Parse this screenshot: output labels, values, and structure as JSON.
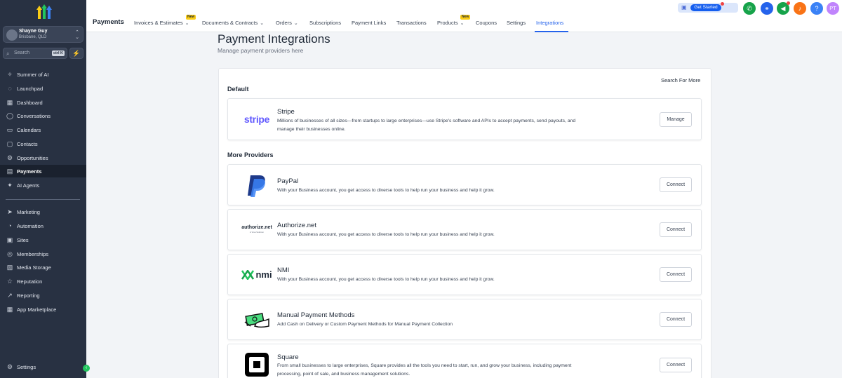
{
  "sidebar": {
    "account": {
      "name": "Shayne Guy",
      "location": "Brisbane, QLD"
    },
    "search": {
      "placeholder": "Search",
      "shortcut": "ctrl K"
    },
    "items": [
      {
        "label": "Summer of AI",
        "icon": "sparkle-icon"
      },
      {
        "label": "Launchpad",
        "icon": "rocket-icon"
      },
      {
        "label": "Dashboard",
        "icon": "grid-icon"
      },
      {
        "label": "Conversations",
        "icon": "chat-icon"
      },
      {
        "label": "Calendars",
        "icon": "calendar-icon"
      },
      {
        "label": "Contacts",
        "icon": "contacts-icon"
      },
      {
        "label": "Opportunities",
        "icon": "opportunities-icon"
      },
      {
        "label": "Payments",
        "icon": "payments-icon",
        "active": true
      },
      {
        "label": "AI Agents",
        "icon": "ai-icon"
      },
      {
        "label": "Marketing",
        "icon": "send-icon"
      },
      {
        "label": "Automation",
        "icon": "automation-icon"
      },
      {
        "label": "Sites",
        "icon": "sites-icon"
      },
      {
        "label": "Memberships",
        "icon": "membership-icon"
      },
      {
        "label": "Media Storage",
        "icon": "media-icon"
      },
      {
        "label": "Reputation",
        "icon": "star-icon"
      },
      {
        "label": "Reporting",
        "icon": "chart-icon"
      },
      {
        "label": "App Marketplace",
        "icon": "apps-icon"
      }
    ],
    "settings_label": "Settings"
  },
  "topbar": {
    "section": "Payments",
    "tabs": [
      {
        "label": "Invoices & Estimates",
        "dropdown": true,
        "badge": "New"
      },
      {
        "label": "Documents & Contracts",
        "dropdown": true
      },
      {
        "label": "Orders",
        "dropdown": true
      },
      {
        "label": "Subscriptions"
      },
      {
        "label": "Payment Links"
      },
      {
        "label": "Transactions"
      },
      {
        "label": "Products",
        "dropdown": true,
        "badge": "New"
      },
      {
        "label": "Coupons"
      },
      {
        "label": "Settings"
      },
      {
        "label": "Integrations",
        "active": true
      }
    ],
    "get_started": "Get Started",
    "user_initials": "PT",
    "colors": {
      "accent": "#2563eb",
      "phone": "#16a34a",
      "megaphone": "#16a34a",
      "bell": "#f97316",
      "help": "#3b82f6",
      "avatar": "#c084fc"
    }
  },
  "page": {
    "title": "Payment Integrations",
    "subtitle": "Manage payment providers here",
    "search_more": "Search For More",
    "default_title": "Default",
    "more_title": "More Providers"
  },
  "providers": [
    {
      "name": "Stripe",
      "logo": "stripe",
      "description": "Millions of businesses of all sizes—from startups to large enterprises—use Stripe's software and APIs to accept payments, send payouts, and manage their businesses online.",
      "button": "Manage"
    },
    {
      "name": "PayPal",
      "logo": "paypal",
      "description": "With your Business account, you get access to diverse tools to help run your business and help it grow.",
      "button": "Connect"
    },
    {
      "name": "Authorize.net",
      "logo": "authorize.net",
      "logo_sub": "A Visa Solution",
      "description": "With your Business account, you get access to diverse tools to help run your business and help it grow.",
      "button": "Connect"
    },
    {
      "name": "NMI",
      "logo": "nmi",
      "description": "With your Business account, you get access to diverse tools to help run your business and help it grow.",
      "button": "Connect"
    },
    {
      "name": "Manual Payment Methods",
      "logo": "cash-hand-icon",
      "description": "Add Cash on Delivery or Custom Payment Methods for Manual Payment Collection",
      "button": "Connect"
    },
    {
      "name": "Square",
      "logo": "square-icon",
      "description": "From small businesses to large enterprises, Square provides all the tools you need to start, run, and grow your business, including payment processing, point of sale, and business management solutions.",
      "button": "Connect"
    }
  ]
}
